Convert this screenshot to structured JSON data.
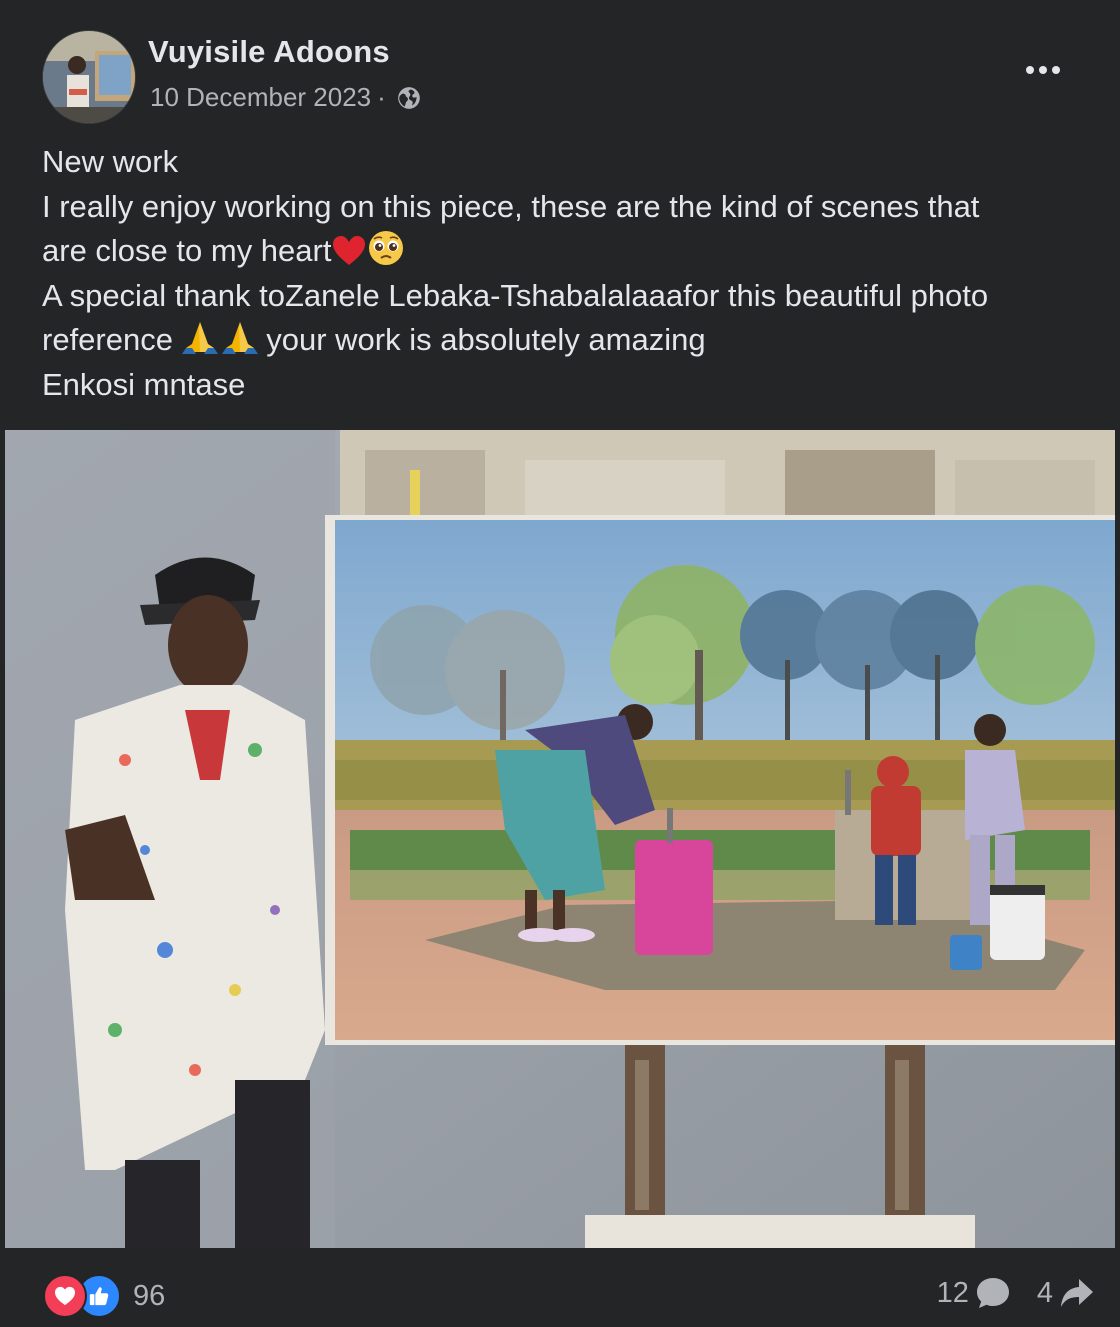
{
  "post": {
    "author": "Vuyisile Adoons",
    "date": "10 December 2023",
    "separator": "·",
    "privacy_icon": "globe-icon",
    "more_icon": "more-options-icon",
    "lines": [
      "New work",
      "I really enjoy working on this piece, these are the kind of scenes that",
      "are close to my heart",
      "A special thank toZanele Lebaka-Tshabalalaaafor this beautiful photo",
      "reference",
      "your work is absolutely amazing",
      "Enkosi mntase"
    ]
  },
  "footer": {
    "reaction_icons": [
      "love-icon",
      "like-icon"
    ],
    "reaction_count": "96",
    "comment_count": "12",
    "share_count": "4",
    "comment_icon": "comment-icon",
    "share_icon": "share-icon"
  },
  "colors": {
    "background": "#242526",
    "text_primary": "#e4e6eb",
    "text_secondary": "#b0b3b8",
    "love": "#f33e58",
    "like": "#2d88ff"
  }
}
